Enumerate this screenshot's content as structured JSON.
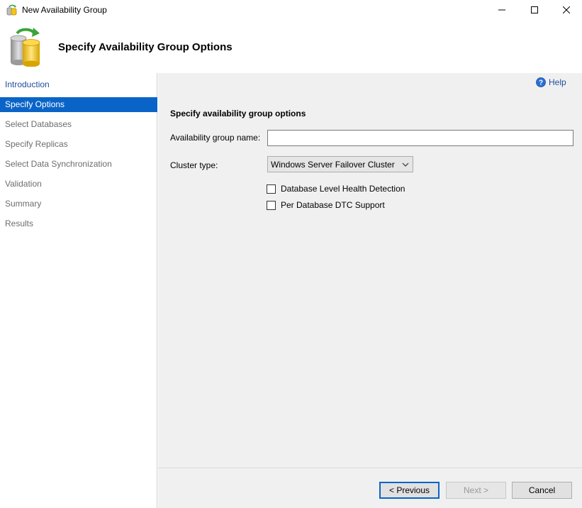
{
  "window": {
    "title": "New Availability Group"
  },
  "header": {
    "title": "Specify Availability Group Options"
  },
  "nav": {
    "items": [
      {
        "label": "Introduction"
      },
      {
        "label": "Specify Options"
      },
      {
        "label": "Select Databases"
      },
      {
        "label": "Specify Replicas"
      },
      {
        "label": "Select Data Synchronization"
      },
      {
        "label": "Validation"
      },
      {
        "label": "Summary"
      },
      {
        "label": "Results"
      }
    ],
    "active_index": 1
  },
  "content": {
    "help_label": "Help",
    "section_title": "Specify availability group options",
    "name_label": "Availability group name:",
    "name_value": "",
    "cluster_label": "Cluster type:",
    "cluster_value": "Windows Server Failover Cluster",
    "checkbox_health": {
      "label": "Database Level Health Detection",
      "checked": false
    },
    "checkbox_dtc": {
      "label": "Per Database DTC Support",
      "checked": false
    }
  },
  "buttons": {
    "previous": "< Previous",
    "next": "Next >",
    "cancel": "Cancel"
  },
  "colors": {
    "accent": "#0a64c8",
    "link": "#1f4e9c",
    "panel": "#f0f0f0"
  }
}
